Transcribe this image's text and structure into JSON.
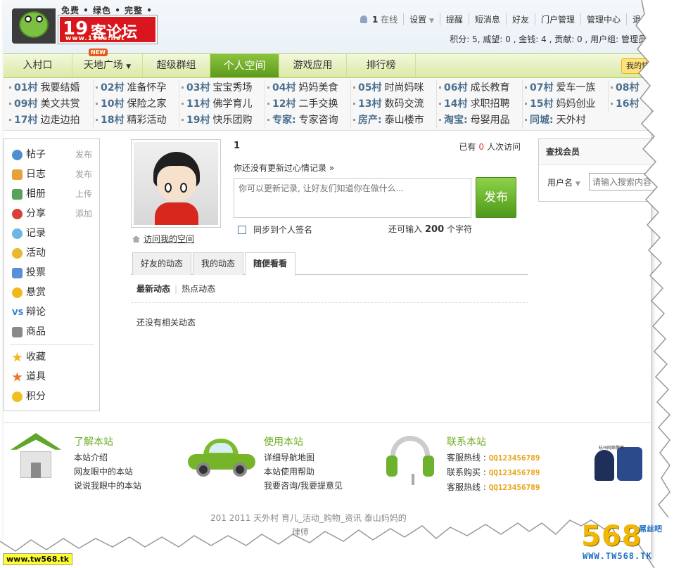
{
  "logo": {
    "slogan": "免费 • 绿色 • 完整 • 安全",
    "brand_num": "19",
    "brand_text": "客论坛",
    "brand_url": "www.19ke.net"
  },
  "topnav": {
    "online_count": "1",
    "online_label": "在线",
    "settings": "设置",
    "items": [
      "提醒",
      "短消息",
      "好友",
      "门户管理",
      "管理中心",
      "退"
    ]
  },
  "stats": "积分: 5, 威望: 0 , 金钱: 4 , 贡献: 0 , 用户组: 管理员",
  "mainnav": {
    "items": [
      "入村口",
      "天地广场",
      "超级群组",
      "个人空间",
      "游戏应用",
      "排行榜"
    ],
    "new_badge": "NEW",
    "quick": "我的快"
  },
  "village": {
    "rows": [
      [
        {
          "num": "01村",
          "name": "我要结婚"
        },
        {
          "num": "02村",
          "name": "准备怀孕"
        },
        {
          "num": "03村",
          "name": "宝宝秀场"
        },
        {
          "num": "04村",
          "name": "妈妈美食"
        },
        {
          "num": "05村",
          "name": "时尚妈咪"
        },
        {
          "num": "06村",
          "name": "成长教育"
        },
        {
          "num": "07村",
          "name": "爱车一族"
        },
        {
          "num": "08村",
          "name": ""
        }
      ],
      [
        {
          "num": "09村",
          "name": "美文共赏"
        },
        {
          "num": "10村",
          "name": "保险之家"
        },
        {
          "num": "11村",
          "name": "佛学育儿"
        },
        {
          "num": "12村",
          "name": "二手交换"
        },
        {
          "num": "13村",
          "name": "数码交流"
        },
        {
          "num": "14村",
          "name": "求职招聘"
        },
        {
          "num": "15村",
          "name": "妈妈创业"
        },
        {
          "num": "16村",
          "name": ""
        }
      ],
      [
        {
          "num": "17村",
          "name": "边走边拍"
        },
        {
          "num": "18村",
          "name": "精彩活动"
        },
        {
          "num": "19村",
          "name": "快乐团购"
        },
        {
          "num": "专家:",
          "name": "专家咨询"
        },
        {
          "num": "房产:",
          "name": "泰山楼市"
        },
        {
          "num": "淘宝:",
          "name": "母婴用品"
        },
        {
          "num": "同城:",
          "name": "天外村"
        }
      ]
    ]
  },
  "sidebar": {
    "items": [
      {
        "label": "帖子",
        "action": "发布",
        "icon": "post-icon",
        "color": "#4f8fd0"
      },
      {
        "label": "日志",
        "action": "发布",
        "icon": "blog-icon",
        "color": "#e8a03a"
      },
      {
        "label": "相册",
        "action": "上传",
        "icon": "album-icon",
        "color": "#5aa25a"
      },
      {
        "label": "分享",
        "action": "添加",
        "icon": "share-icon",
        "color": "#d8403a"
      },
      {
        "label": "记录",
        "action": "",
        "icon": "record-icon",
        "color": "#6fb6e6"
      },
      {
        "label": "活动",
        "action": "",
        "icon": "activity-icon",
        "color": "#e8b830"
      },
      {
        "label": "投票",
        "action": "",
        "icon": "vote-icon",
        "color": "#5a8ed8"
      },
      {
        "label": "悬赏",
        "action": "",
        "icon": "reward-icon",
        "color": "#f0b81e"
      },
      {
        "label": "辩论",
        "action": "",
        "icon": "debate-icon",
        "color": "#2c7fd0"
      },
      {
        "label": "商品",
        "action": "",
        "icon": "goods-icon",
        "color": "#8a8a8a"
      },
      {
        "label": "收藏",
        "action": "",
        "icon": "favorite-icon",
        "color": "#f0b81e"
      },
      {
        "label": "道具",
        "action": "",
        "icon": "prop-icon",
        "color": "#e87a2a"
      },
      {
        "label": "积分",
        "action": "",
        "icon": "credit-icon",
        "color": "#f0c020"
      }
    ]
  },
  "profile": {
    "username": "1",
    "visits_prefix": "已有",
    "visits_count": "0",
    "visits_suffix": "人次访问",
    "mood_title": "你还没有更新过心情记录 »",
    "mood_placeholder": "你可以更新记录, 让好友们知道你在做什么...",
    "publish": "发布",
    "sync_label": "同步到个人签名",
    "remain_prefix": "还可输入",
    "remain_count": "200",
    "remain_suffix": "个字符",
    "visit_space": "访问我的空间"
  },
  "feed": {
    "tabs": [
      "好友的动态",
      "我的动态",
      "随便看看"
    ],
    "active_tab": "随便看看",
    "subtabs": [
      "最新动态",
      "热点动态"
    ],
    "empty": "还没有相关动态"
  },
  "find_member": {
    "title": "查找会员",
    "field_label": "用户名",
    "placeholder": "请输入搜索内容"
  },
  "footer": {
    "cols": [
      {
        "title": "了解本站",
        "items": [
          "本站介绍",
          "网友眼中的本站",
          "说说我眼中的本站"
        ]
      },
      {
        "title": "使用本站",
        "items": [
          "详细导航地图",
          "本站使用帮助",
          "我要咨询/我要提意见"
        ]
      },
      {
        "title": "联系本站",
        "items": [
          {
            "label": "客服热线 :",
            "qq": "QQ123456789"
          },
          {
            "label": "联系购买 :",
            "qq": "QQ123456789"
          },
          {
            "label": "客服热线 :",
            "qq": "QQ123456789"
          }
        ]
      }
    ],
    "police_text": "杭州网络警察",
    "copyright": "201  2011 天外村  育儿_活动_购物_资讯  泰山妈妈的",
    "copyright2": "律师"
  },
  "watermark": {
    "left": "www.tw568.tk",
    "big": "568",
    "tag": "屌丝吧",
    "url": "WWW.TW568.TK"
  },
  "colors": {
    "nav_active": "#6fae2a",
    "publish": "#5fae22",
    "accent_green": "#6aab1e",
    "qq_orange": "#e8a317",
    "visits_red": "#e4393c"
  }
}
